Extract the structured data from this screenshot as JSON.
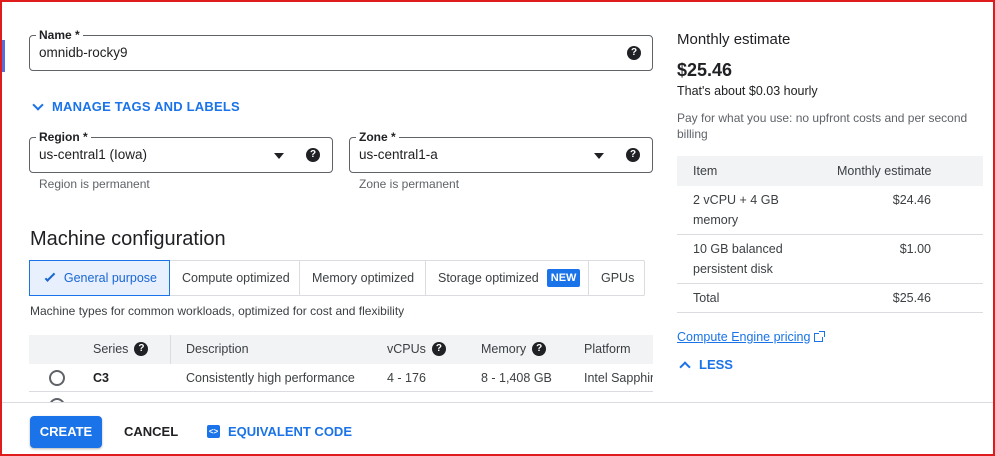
{
  "name_field": {
    "label": "Name *",
    "value": "omnidb-rocky9"
  },
  "manage_tags": "MANAGE TAGS AND LABELS",
  "region_field": {
    "label": "Region *",
    "value": "us-central1 (Iowa)",
    "hint": "Region is permanent"
  },
  "zone_field": {
    "label": "Zone *",
    "value": "us-central1-a",
    "hint": "Zone is permanent"
  },
  "machine_config": {
    "title": "Machine configuration",
    "tabs": [
      {
        "label": "General purpose",
        "selected": true
      },
      {
        "label": "Compute optimized"
      },
      {
        "label": "Memory optimized"
      },
      {
        "label": "Storage optimized",
        "badge": "NEW"
      },
      {
        "label": "GPUs"
      }
    ],
    "description": "Machine types for common workloads, optimized for cost and flexibility",
    "table": {
      "headers": {
        "series": "Series",
        "description": "Description",
        "vcpus": "vCPUs",
        "memory": "Memory",
        "platform": "Platform"
      },
      "rows": [
        {
          "series": "C3",
          "description": "Consistently high performance",
          "vcpus": "4 - 176",
          "memory": "8 - 1,408 GB",
          "platform": "Intel Sapphire Rapids"
        }
      ]
    }
  },
  "actions": {
    "create": "CREATE",
    "cancel": "CANCEL",
    "equivalent_code": "EQUIVALENT CODE"
  },
  "estimate": {
    "title": "Monthly estimate",
    "price": "$25.46",
    "hourly": "That's about $0.03 hourly",
    "note": "Pay for what you use: no upfront costs and per second billing",
    "table": {
      "header_item": "Item",
      "header_estimate": "Monthly estimate",
      "rows": [
        {
          "item": "2 vCPU + 4 GB memory",
          "cost": "$24.46"
        },
        {
          "item": "10 GB balanced persistent disk",
          "cost": "$1.00"
        },
        {
          "item": "Total",
          "cost": "$25.46"
        }
      ]
    },
    "pricing_link": "Compute Engine pricing",
    "less": "LESS"
  },
  "colors": {
    "accent": "#1a73e8",
    "frame": "#e01b1b",
    "selected_tab_bg": "#e8f0fe"
  }
}
